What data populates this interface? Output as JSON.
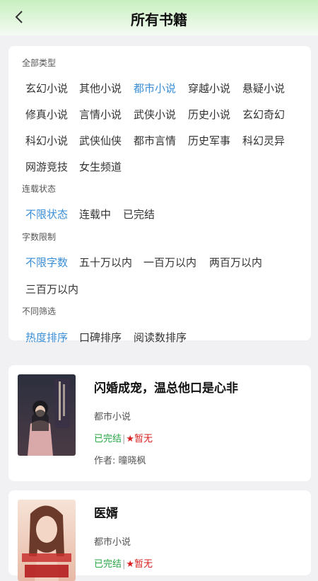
{
  "header": {
    "title": "所有书籍"
  },
  "filters": {
    "type_label": "全部类型",
    "types": [
      "玄幻小说",
      "其他小说",
      "都市小说",
      "穿越小说",
      "悬疑小说",
      "修真小说",
      "言情小说",
      "武侠小说",
      "历史小说",
      "玄幻奇幻",
      "科幻小说",
      "武侠仙侠",
      "都市言情",
      "历史军事",
      "科幻灵异",
      "网游竞技",
      "女生频道"
    ],
    "type_selected": "都市小说",
    "status_label": "连载状态",
    "statuses": [
      "不限状态",
      "连载中",
      "已完结"
    ],
    "status_selected": "不限状态",
    "words_label": "字数限制",
    "words": [
      "不限字数",
      "五十万以内",
      "一百万以内",
      "两百万以内",
      "三百万以内"
    ],
    "words_selected": "不限字数",
    "sort_label": "不同筛选",
    "sorts": [
      "热度排序",
      "口碑排序",
      "阅读数排序"
    ],
    "sort_selected": "热度排序"
  },
  "books": [
    {
      "title": "闪婚成宠，温总他口是心非",
      "category": "都市小说",
      "status": "已完结",
      "rating": "★暂无",
      "author": "作者: 曈晓枫"
    },
    {
      "title": "医婿",
      "category": "都市小说",
      "status": "已完结",
      "rating": "★暂无"
    }
  ],
  "colors": {
    "selected": "#3a8ed6",
    "status_green": "#27a645",
    "rating_red": "#d81e1e"
  }
}
